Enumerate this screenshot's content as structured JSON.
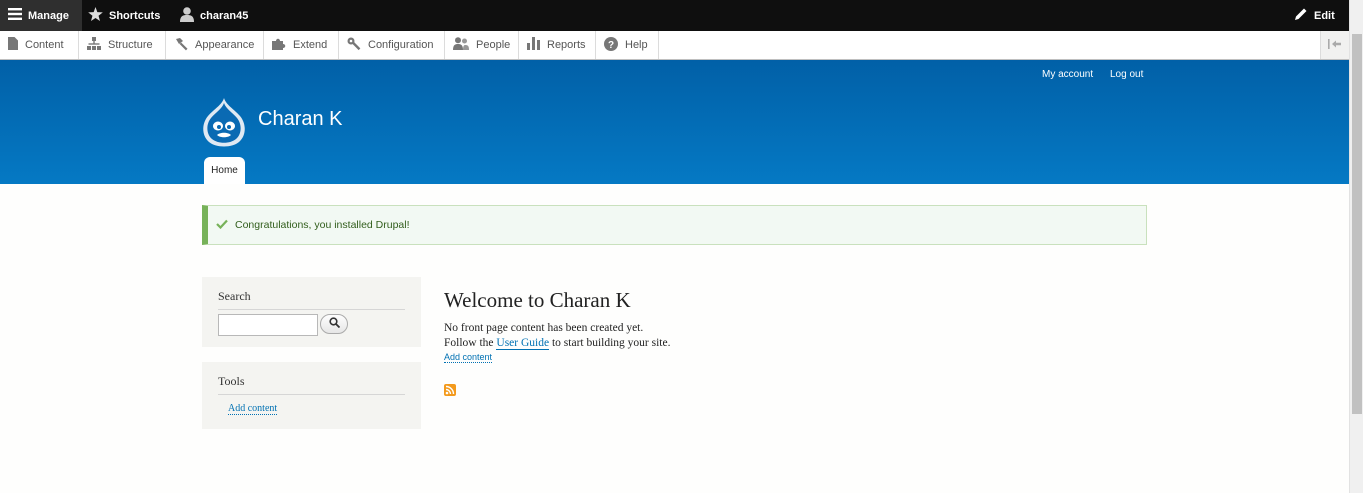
{
  "toolbar": {
    "manage_label": "Manage",
    "shortcuts_label": "Shortcuts",
    "user_label": "charan45",
    "edit_label": "Edit"
  },
  "tray": {
    "items": [
      {
        "label": "Content",
        "icon": "content-icon"
      },
      {
        "label": "Structure",
        "icon": "structure-icon"
      },
      {
        "label": "Appearance",
        "icon": "appearance-icon"
      },
      {
        "label": "Extend",
        "icon": "extend-icon"
      },
      {
        "label": "Configuration",
        "icon": "configuration-icon"
      },
      {
        "label": "People",
        "icon": "people-icon"
      },
      {
        "label": "Reports",
        "icon": "reports-icon"
      },
      {
        "label": "Help",
        "icon": "help-icon"
      }
    ]
  },
  "header": {
    "my_account": "My account",
    "log_out": "Log out",
    "site_name": "Charan K",
    "home_tab": "Home",
    "colors": {
      "gradient_top": "#0160a7",
      "gradient_bottom": "#0579c4"
    }
  },
  "message": {
    "text": "Congratulations, you installed Drupal!",
    "color": "#77b259"
  },
  "sidebar": {
    "search_title": "Search",
    "search_value": "",
    "tools_title": "Tools",
    "tools_link": "Add content"
  },
  "main": {
    "title": "Welcome to Charan K",
    "line1": "No front page content has been created yet.",
    "line2_prefix": "Follow the ",
    "line2_link": "User Guide",
    "line2_suffix": " to start building your site.",
    "add_content": "Add content",
    "feed_icon": "rss-feed-icon"
  }
}
